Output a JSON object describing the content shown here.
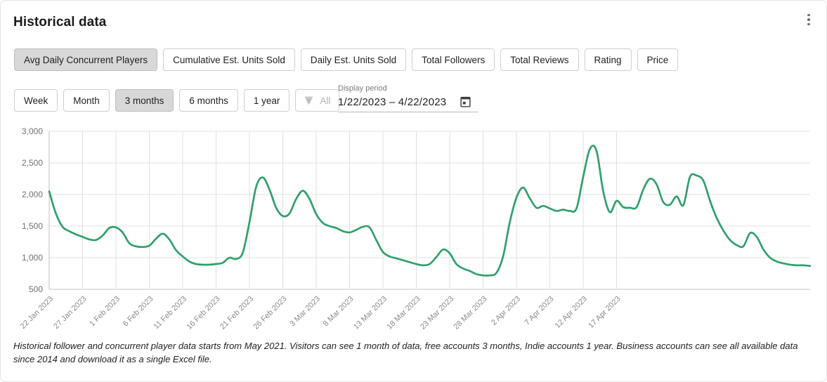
{
  "header": {
    "title": "Historical data",
    "menu_icon": "kebab-menu-icon"
  },
  "metrics": {
    "selected": "Avg Daily Concurrent Players",
    "items": [
      {
        "label": "Avg Daily Concurrent Players",
        "active": true
      },
      {
        "label": "Cumulative Est. Units Sold",
        "active": false
      },
      {
        "label": "Daily Est. Units Sold",
        "active": false
      },
      {
        "label": "Total Followers",
        "active": false
      },
      {
        "label": "Total Reviews",
        "active": false
      },
      {
        "label": "Rating",
        "active": false
      },
      {
        "label": "Price",
        "active": false
      }
    ]
  },
  "periods": {
    "selected": "3 months",
    "items": [
      {
        "label": "Week",
        "active": false,
        "disabled": false,
        "icon": null
      },
      {
        "label": "Month",
        "active": false,
        "disabled": false,
        "icon": null
      },
      {
        "label": "3 months",
        "active": true,
        "disabled": false,
        "icon": null
      },
      {
        "label": "6 months",
        "active": false,
        "disabled": false,
        "icon": null
      },
      {
        "label": "1 year",
        "active": false,
        "disabled": false,
        "icon": null
      },
      {
        "label": "All",
        "active": false,
        "disabled": true,
        "icon": "gem-premium-icon"
      }
    ]
  },
  "display_period": {
    "label": "Display period",
    "value": "1/22/2023 – 4/22/2023",
    "icon": "calendar-icon"
  },
  "footnote": "Historical follower and concurrent player data starts from May 2021. Visitors can see 1 month of data, free accounts 3 months, Indie accounts 1 year. Business accounts can see all available data since 2014 and download it as a single Excel file.",
  "colors": {
    "series": "#30a06a",
    "grid": "#e0e0e0",
    "axis": "#c2c2c2",
    "active_button_bg": "#d8d8d8",
    "card_border": "#e3e3e3"
  },
  "chart_data": {
    "type": "line",
    "title": "Avg Daily Concurrent Players",
    "xlabel": "",
    "ylabel": "",
    "grid": true,
    "legend": "none",
    "ylim": [
      500,
      3000
    ],
    "yticks": [
      "500",
      "1,000",
      "1,500",
      "2,000",
      "2,500",
      "3,000"
    ],
    "ytick_values": [
      500,
      1000,
      1500,
      2000,
      2500,
      3000
    ],
    "xtick_labels": [
      "22 Jan 2023",
      "27 Jan 2023",
      "1 Feb 2023",
      "6 Feb 2023",
      "11 Feb 2023",
      "16 Feb 2023",
      "21 Feb 2023",
      "26 Feb 2023",
      "3 Mar 2023",
      "8 Mar 2023",
      "13 Mar 2023",
      "18 Mar 2023",
      "23 Mar 2023",
      "28 Mar 2023",
      "2 Apr 2023",
      "7 Apr 2023",
      "12 Apr 2023",
      "17 Apr 2023"
    ],
    "xtick_label_rotation": -45,
    "series": [
      {
        "name": "Avg Daily Concurrent Players",
        "color": "#30a06a",
        "x": [
          "22 Jan 2023",
          "23 Jan 2023",
          "24 Jan 2023",
          "25 Jan 2023",
          "26 Jan 2023",
          "27 Jan 2023",
          "28 Jan 2023",
          "29 Jan 2023",
          "30 Jan 2023",
          "31 Jan 2023",
          "1 Feb 2023",
          "2 Feb 2023",
          "3 Feb 2023",
          "4 Feb 2023",
          "5 Feb 2023",
          "6 Feb 2023",
          "7 Feb 2023",
          "8 Feb 2023",
          "9 Feb 2023",
          "10 Feb 2023",
          "11 Feb 2023",
          "12 Feb 2023",
          "13 Feb 2023",
          "14 Feb 2023",
          "15 Feb 2023",
          "16 Feb 2023",
          "17 Feb 2023",
          "18 Feb 2023",
          "19 Feb 2023",
          "20 Feb 2023",
          "21 Feb 2023",
          "22 Feb 2023",
          "23 Feb 2023",
          "24 Feb 2023",
          "25 Feb 2023",
          "26 Feb 2023",
          "27 Feb 2023",
          "28 Feb 2023",
          "1 Mar 2023",
          "2 Mar 2023",
          "3 Mar 2023",
          "4 Mar 2023",
          "5 Mar 2023",
          "6 Mar 2023",
          "7 Mar 2023",
          "8 Mar 2023",
          "9 Mar 2023",
          "10 Mar 2023",
          "11 Mar 2023",
          "12 Mar 2023",
          "13 Mar 2023",
          "14 Mar 2023",
          "15 Mar 2023",
          "16 Mar 2023",
          "17 Mar 2023",
          "18 Mar 2023",
          "19 Mar 2023",
          "20 Mar 2023",
          "21 Mar 2023",
          "22 Mar 2023",
          "23 Mar 2023",
          "24 Mar 2023",
          "25 Mar 2023",
          "26 Mar 2023",
          "27 Mar 2023",
          "28 Mar 2023",
          "29 Mar 2023",
          "30 Mar 2023",
          "31 Mar 2023",
          "1 Apr 2023",
          "2 Apr 2023",
          "3 Apr 2023",
          "4 Apr 2023",
          "5 Apr 2023",
          "6 Apr 2023",
          "7 Apr 2023",
          "8 Apr 2023",
          "9 Apr 2023",
          "10 Apr 2023",
          "11 Apr 2023",
          "12 Apr 2023",
          "13 Apr 2023",
          "14 Apr 2023",
          "15 Apr 2023",
          "16 Apr 2023",
          "17 Apr 2023",
          "18 Apr 2023",
          "19 Apr 2023",
          "20 Apr 2023",
          "21 Apr 2023",
          "22 Apr 2023"
        ],
        "values": [
          2050,
          1700,
          1490,
          1420,
          1370,
          1330,
          1290,
          1280,
          1350,
          1470,
          1480,
          1400,
          1230,
          1180,
          1170,
          1190,
          1300,
          1380,
          1290,
          1120,
          1020,
          940,
          900,
          890,
          890,
          900,
          920,
          1000,
          980,
          1080,
          1560,
          2120,
          2270,
          2080,
          1790,
          1660,
          1700,
          1930,
          2060,
          1930,
          1690,
          1550,
          1500,
          1470,
          1420,
          1400,
          1440,
          1490,
          1480,
          1280,
          1090,
          1020,
          990,
          960,
          930,
          900,
          880,
          900,
          1010,
          1130,
          1070,
          900,
          830,
          790,
          740,
          720,
          720,
          760,
          1020,
          1560,
          1950,
          2110,
          1940,
          1790,
          1820,
          1780,
          1740,
          1760,
          1740,
          1780,
          2280,
          2720,
          2690,
          2050,
          1720,
          1900,
          1800,
          1790,
          1800,
          2080,
          2250,
          2160,
          1880,
          1840,
          1970,
          1830,
          2280,
          2300,
          2220,
          1900,
          1630,
          1430,
          1280,
          1200,
          1180,
          1390,
          1330,
          1130,
          1000,
          940,
          910,
          890,
          880,
          880,
          870
        ]
      }
    ]
  }
}
